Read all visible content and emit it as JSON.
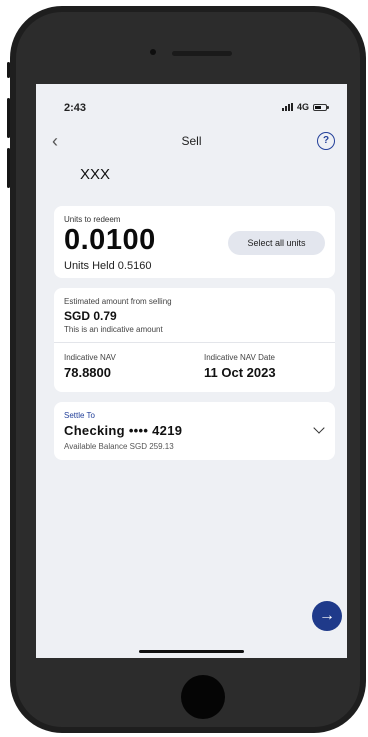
{
  "status_bar": {
    "time": "2:43",
    "network": "4G",
    "battery_level": 0.55
  },
  "nav": {
    "back_icon": "chevron-left-icon",
    "title": "Sell",
    "help_icon": "question-circle-icon",
    "help_glyph": "?"
  },
  "fund": {
    "name": "XXX"
  },
  "redeem": {
    "label": "Units to redeem",
    "units": "0.0100",
    "units_held": "Units Held 0.5160",
    "select_all_label": "Select all units"
  },
  "estimate": {
    "label": "Estimated amount from selling",
    "amount": "SGD 0.79",
    "note": "This is an indicative amount",
    "nav_label": "Indicative NAV",
    "nav_value": "78.8800",
    "nav_date_label": "Indicative NAV Date",
    "nav_date_value": "11 Oct 2023"
  },
  "settle": {
    "label": "Settle To",
    "account": "Checking •••• 4219",
    "balance": "Available Balance SGD 259.13"
  },
  "next_button": {
    "icon": "arrow-right-icon",
    "glyph": "→"
  },
  "colors": {
    "accent": "#1f3a8a",
    "background": "#eef0f4",
    "card": "#ffffff"
  }
}
